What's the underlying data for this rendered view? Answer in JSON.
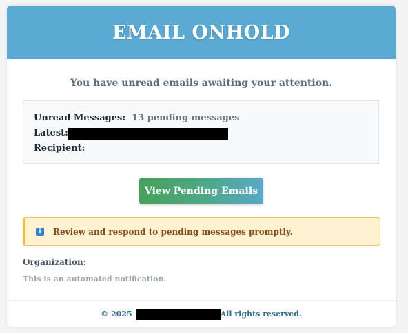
{
  "header": {
    "title": "EMAIL ONHOLD"
  },
  "intro": "You have unread emails awaiting your attention.",
  "details": {
    "unread_label": "Unread Messages:",
    "unread_value": "13 pending messages",
    "latest_label": "Latest:",
    "recipient_label": "Recipient:"
  },
  "button": {
    "label": "View Pending Emails"
  },
  "notice": {
    "icon": "info-icon",
    "text": "Review and respond to pending messages promptly."
  },
  "organization_label": "Organization:",
  "automated_text": "This is an automated notification.",
  "footer": {
    "copyright": "© 2025",
    "rights": "All rights reserved."
  },
  "colors": {
    "header": "#5aaad4",
    "button_start": "#47a05a",
    "button_end": "#58a8c6",
    "notice_bg": "#fdf3d3"
  }
}
